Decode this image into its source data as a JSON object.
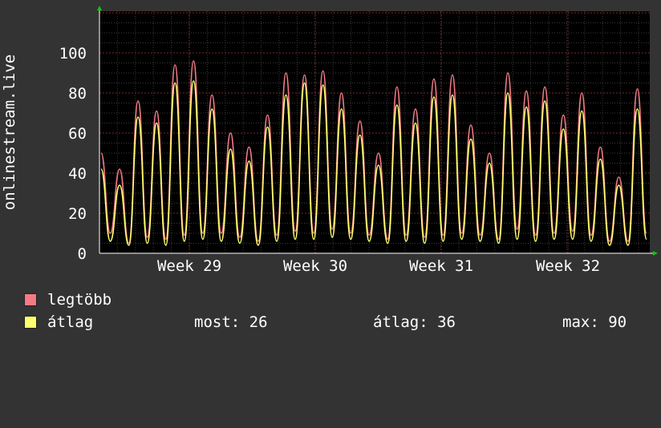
{
  "chart_data": {
    "type": "line",
    "ylabel": "onlinestream.live",
    "ylim": [
      0,
      120
    ],
    "yticks": [
      0,
      20,
      40,
      60,
      80,
      100
    ],
    "xticks": [
      "Week 29",
      "Week 30",
      "Week 31",
      "Week 32"
    ],
    "grid": true,
    "series": [
      {
        "name": "legtöbb",
        "color": "#f47a85",
        "values": [
          50,
          10,
          42,
          5,
          76,
          8,
          71,
          7,
          94,
          9,
          96,
          10,
          79,
          10,
          60,
          8,
          53,
          6,
          69,
          9,
          90,
          11,
          89,
          10,
          91,
          12,
          80,
          10,
          66,
          9,
          50,
          7,
          83,
          9,
          72,
          8,
          87,
          9,
          89,
          10,
          64,
          9,
          50,
          7,
          90,
          12,
          81,
          9,
          83,
          10,
          69,
          11,
          80,
          9,
          53,
          6,
          38,
          6,
          82,
          10
        ]
      },
      {
        "name": "átlag",
        "color": "#ffff6e",
        "values": [
          42,
          6,
          34,
          4,
          68,
          5,
          65,
          4,
          85,
          6,
          86,
          7,
          72,
          6,
          52,
          5,
          46,
          4,
          63,
          6,
          79,
          7,
          85,
          7,
          84,
          8,
          72,
          7,
          59,
          6,
          44,
          5,
          74,
          6,
          65,
          5,
          78,
          6,
          79,
          7,
          57,
          6,
          45,
          5,
          80,
          7,
          73,
          6,
          76,
          7,
          62,
          7,
          71,
          6,
          47,
          4,
          34,
          4,
          72,
          7
        ]
      }
    ],
    "legend_position": "bottom-left"
  },
  "legend": {
    "max_label": "legtöbb",
    "avg_label": "átlag",
    "now_text": "most: 26",
    "average_text": "átlag: 36",
    "max_text": "max: 90"
  }
}
